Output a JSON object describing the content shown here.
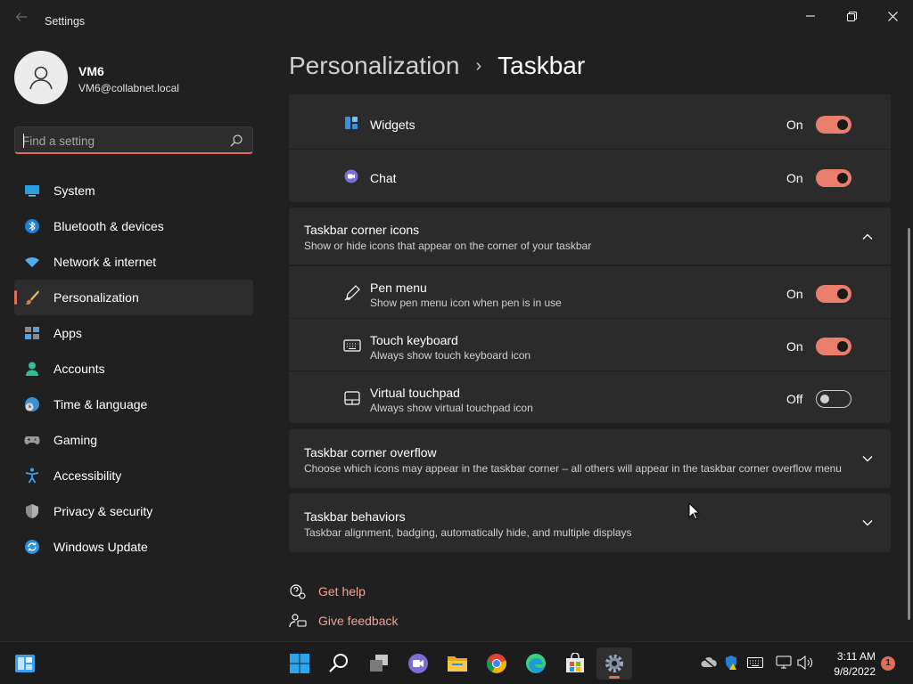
{
  "window": {
    "title": "Settings"
  },
  "user": {
    "name": "VM6",
    "email": "VM6@collabnet.local"
  },
  "search": {
    "placeholder": "Find a setting"
  },
  "sidebar": {
    "items": [
      {
        "label": "System",
        "icon": "monitor-icon"
      },
      {
        "label": "Bluetooth & devices",
        "icon": "bluetooth-icon"
      },
      {
        "label": "Network & internet",
        "icon": "wifi-icon"
      },
      {
        "label": "Personalization",
        "icon": "paintbrush-icon",
        "active": true
      },
      {
        "label": "Apps",
        "icon": "apps-icon"
      },
      {
        "label": "Accounts",
        "icon": "person-icon"
      },
      {
        "label": "Time & language",
        "icon": "globe-clock-icon"
      },
      {
        "label": "Gaming",
        "icon": "gamepad-icon"
      },
      {
        "label": "Accessibility",
        "icon": "accessibility-icon"
      },
      {
        "label": "Privacy & security",
        "icon": "shield-icon"
      },
      {
        "label": "Windows Update",
        "icon": "update-icon"
      }
    ]
  },
  "breadcrumb": {
    "parent": "Personalization",
    "separator": "›",
    "current": "Taskbar"
  },
  "taskbar_items": {
    "widgets": {
      "title": "Widgets",
      "state": "On"
    },
    "chat": {
      "title": "Chat",
      "state": "On"
    }
  },
  "corner_icons": {
    "title": "Taskbar corner icons",
    "subtitle": "Show or hide icons that appear on the corner of your taskbar",
    "items": [
      {
        "title": "Pen menu",
        "subtitle": "Show pen menu icon when pen is in use",
        "state": "On"
      },
      {
        "title": "Touch keyboard",
        "subtitle": "Always show touch keyboard icon",
        "state": "On"
      },
      {
        "title": "Virtual touchpad",
        "subtitle": "Always show virtual touchpad icon",
        "state": "Off"
      }
    ]
  },
  "corner_overflow": {
    "title": "Taskbar corner overflow",
    "subtitle": "Choose which icons may appear in the taskbar corner – all others will appear in the taskbar corner overflow menu"
  },
  "behaviors": {
    "title": "Taskbar behaviors",
    "subtitle": "Taskbar alignment, badging, automatically hide, and multiple displays"
  },
  "links": {
    "help": "Get help",
    "feedback": "Give feedback"
  },
  "clock": {
    "time": "3:11 AM",
    "date": "9/8/2022"
  },
  "notifications": {
    "count": "1"
  },
  "colors": {
    "accent": "#e26d5a",
    "toggle_on": "#e87e6b",
    "background": "#202020",
    "card": "#2b2b2b"
  }
}
